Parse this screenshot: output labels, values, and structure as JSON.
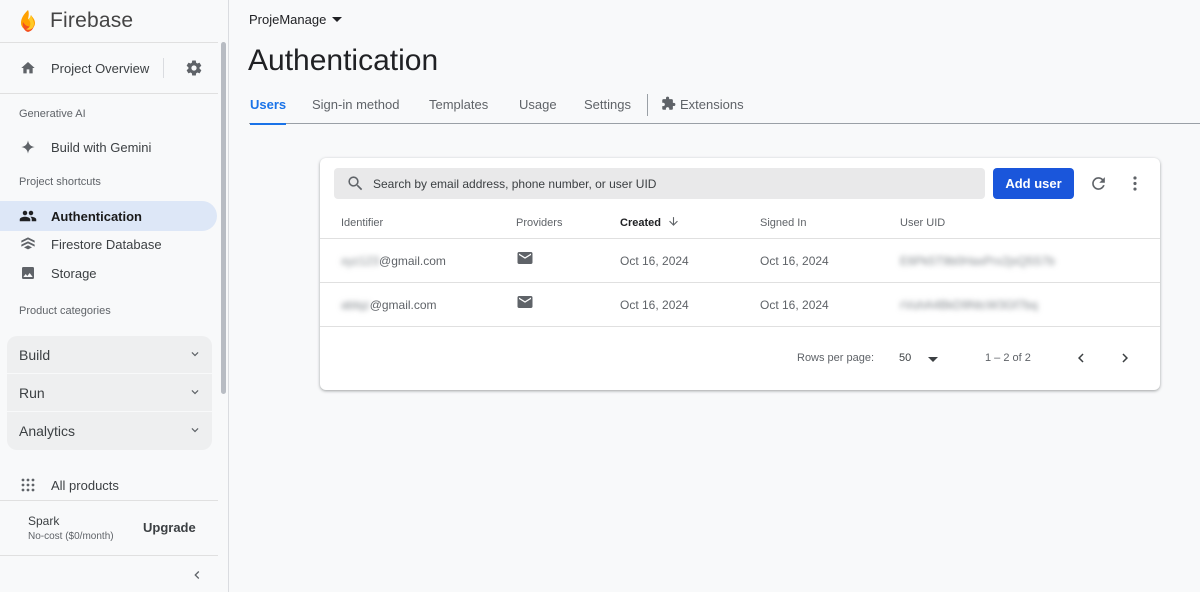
{
  "brand": {
    "name": "Firebase"
  },
  "sidebar": {
    "overview": {
      "label": "Project Overview",
      "icon": "home-icon",
      "settings_icon": "gear-icon"
    },
    "gen_ai": {
      "section": "Generative AI",
      "item": {
        "label": "Build with Gemini",
        "icon": "sparkle-icon"
      }
    },
    "shortcuts": {
      "section": "Project shortcuts",
      "items": [
        {
          "label": "Authentication",
          "icon": "people-icon",
          "active": true
        },
        {
          "label": "Firestore Database",
          "icon": "firestore-icon",
          "active": false
        },
        {
          "label": "Storage",
          "icon": "image-icon",
          "active": false
        }
      ]
    },
    "categories": {
      "section": "Product categories",
      "items": [
        {
          "label": "Build"
        },
        {
          "label": "Run"
        },
        {
          "label": "Analytics"
        }
      ]
    },
    "all_products": {
      "label": "All products",
      "icon": "grid-icon"
    },
    "plan": {
      "name": "Spark",
      "cost": "No-cost ($0/month)",
      "upgrade_label": "Upgrade"
    }
  },
  "header": {
    "project": "ProjeManage",
    "title": "Authentication",
    "tabs": [
      {
        "label": "Users",
        "active": true
      },
      {
        "label": "Sign-in method",
        "active": false
      },
      {
        "label": "Templates",
        "active": false
      },
      {
        "label": "Usage",
        "active": false
      },
      {
        "label": "Settings",
        "active": false
      },
      {
        "label": "Extensions",
        "active": false,
        "icon": "extension-icon"
      }
    ]
  },
  "users_card": {
    "search_placeholder": "Search by email address, phone number, or user UID",
    "add_user_label": "Add user",
    "columns": [
      "Identifier",
      "Providers",
      "Created",
      "Signed In",
      "User UID"
    ],
    "sorted_column": "Created",
    "rows": [
      {
        "identifier_hidden": "xyz123",
        "identifier_domain": "@gmail.com",
        "provider": "mail-icon",
        "created": "Oct 16, 2024",
        "signed_in": "Oct 16, 2024",
        "uid": "E6Pk5T9b0HaxPrx2jsQ5S7b"
      },
      {
        "identifier_hidden": "ablqz",
        "identifier_domain": "@gmail.com",
        "provider": "mail-icon",
        "created": "Oct 16, 2024",
        "signed_in": "Oct 16, 2024",
        "uid": "rVuhA4BkD9NtcW3Gf7bq"
      }
    ],
    "pagination": {
      "rows_per_page_label": "Rows per page:",
      "rows_per_page": "50",
      "range": "1 – 2 of 2"
    }
  },
  "colors": {
    "accent": "#1a73e8",
    "add_button": "#1a56db",
    "active_nav_bg": "#dde7f7"
  }
}
